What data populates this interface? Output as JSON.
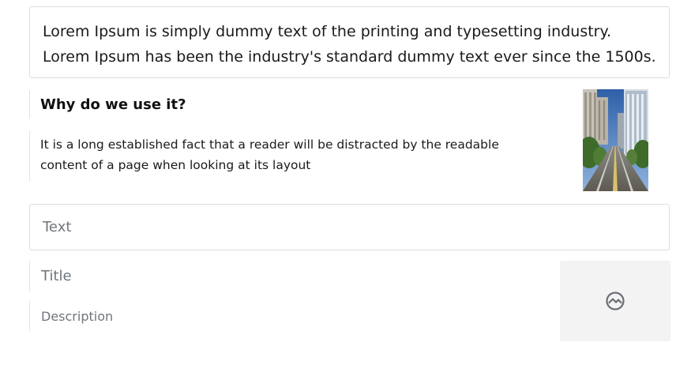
{
  "intro": {
    "text": "Lorem Ipsum is simply dummy text of the printing and typesetting industry. Lorem Ipsum has been the industry's standard dummy text ever since the 1500s."
  },
  "media": {
    "heading": "Why do we use it?",
    "description": "It is a long established fact that a reader will be distracted by the readable content of a page when looking at its layout",
    "image_icon": "city-street-photo"
  },
  "placeholders": {
    "text": "Text",
    "title": "Title",
    "description": "Description",
    "image_icon": "image-placeholder-icon"
  }
}
